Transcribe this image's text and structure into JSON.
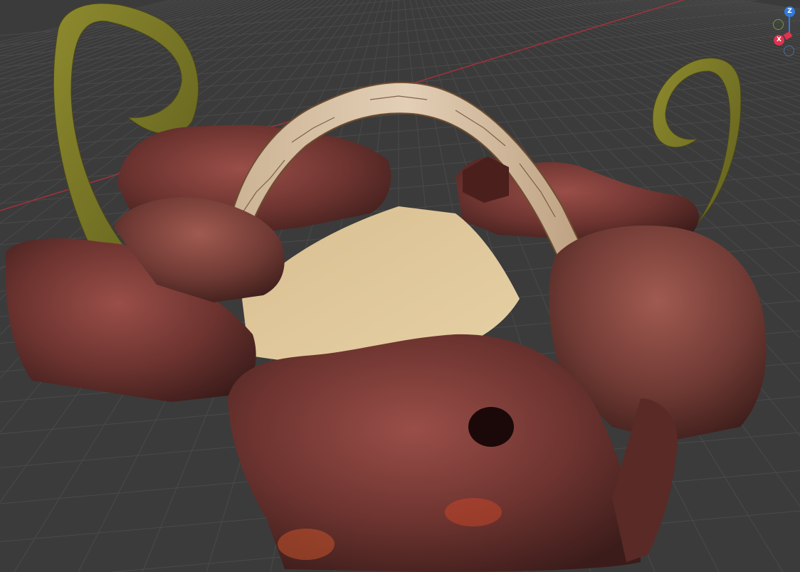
{
  "viewport": {
    "background": "#3b3b3b",
    "grid_color": "#4a4a4a",
    "x_axis_color": "#a4303c",
    "object": "rock-arena-with-horns-and-arch"
  },
  "navigation_gizmo": {
    "z_label": "Z",
    "x_label": "X",
    "z_color": "#2f7be0",
    "x_color": "#e0334e",
    "y_color": "#6e9d3a",
    "x_neg_color": "#4b6f9c"
  },
  "icons": {
    "gizmo": "axis-gizmo-icon"
  }
}
